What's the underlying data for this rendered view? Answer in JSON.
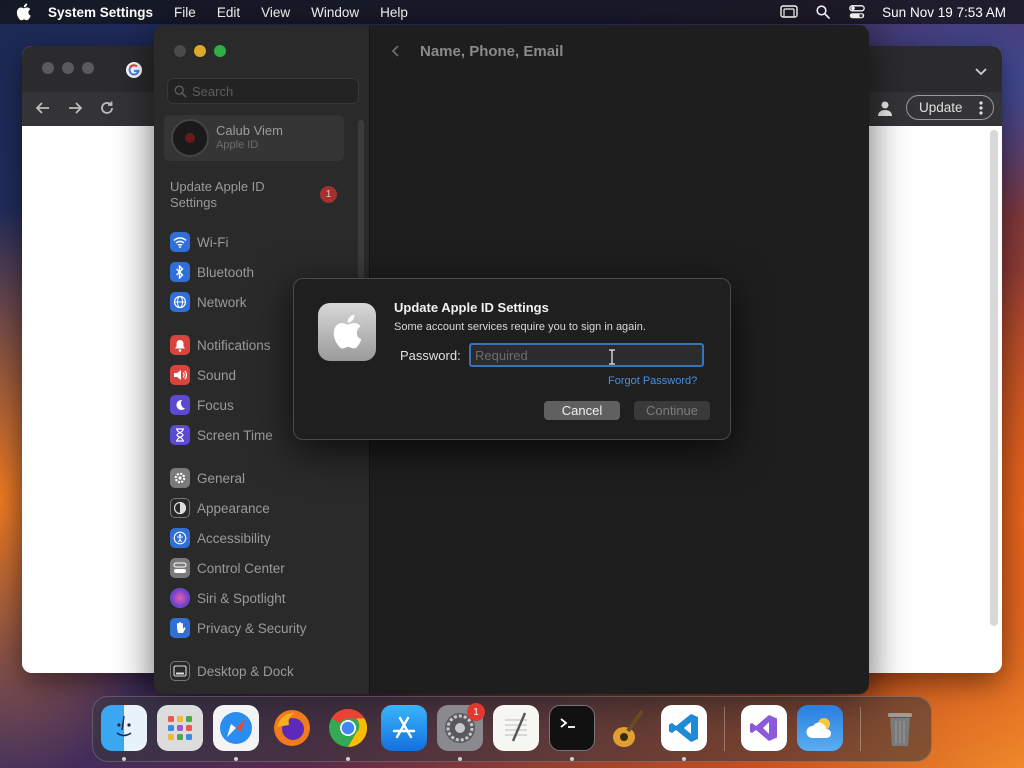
{
  "menubar": {
    "app_name": "System Settings",
    "items": [
      "File",
      "Edit",
      "View",
      "Window",
      "Help"
    ],
    "clock": "Sun Nov 19  7:53 AM"
  },
  "chrome": {
    "update_label": "Update"
  },
  "settings": {
    "search_placeholder": "Search",
    "profile": {
      "name": "Calub Viem",
      "subtitle": "Apple ID"
    },
    "update_item": {
      "label": "Update Apple ID Settings",
      "badge": "1"
    },
    "sidebar_items": [
      {
        "label": "Wi-Fi",
        "icon": "wifi-icon",
        "color": "#2f6fd6"
      },
      {
        "label": "Bluetooth",
        "icon": "bluetooth-icon",
        "color": "#2f6fd6"
      },
      {
        "label": "Network",
        "icon": "network-globe-icon",
        "color": "#2f6fd6"
      },
      {
        "label": "Notifications",
        "icon": "bell-icon",
        "color": "#d9453c"
      },
      {
        "label": "Sound",
        "icon": "speaker-icon",
        "color": "#d9453c"
      },
      {
        "label": "Focus",
        "icon": "moon-icon",
        "color": "#5a4bd0"
      },
      {
        "label": "Screen Time",
        "icon": "hourglass-icon",
        "color": "#5a4bd0"
      },
      {
        "label": "General",
        "icon": "gear-icon",
        "color": "#7a7a7a"
      },
      {
        "label": "Appearance",
        "icon": "appearance-icon",
        "color": "#2a2a2a"
      },
      {
        "label": "Accessibility",
        "icon": "accessibility-icon",
        "color": "#2f6fd6"
      },
      {
        "label": "Control Center",
        "icon": "control-center-icon",
        "color": "#7a7a7a"
      },
      {
        "label": "Siri & Spotlight",
        "icon": "siri-icon",
        "color": "#b0489e"
      },
      {
        "label": "Privacy & Security",
        "icon": "hand-icon",
        "color": "#2f6fd6"
      },
      {
        "label": "Desktop & Dock",
        "icon": "dock-icon",
        "color": "#2a2a2a"
      }
    ],
    "main_title": "Name, Phone, Email"
  },
  "dialog": {
    "title": "Update Apple ID Settings",
    "message": "Some account services require you to sign in again.",
    "password_label": "Password:",
    "password_placeholder": "Required",
    "password_value": "",
    "forgot_link": "Forgot Password?",
    "cancel_label": "Cancel",
    "continue_label": "Continue"
  },
  "dock": {
    "apps": [
      {
        "name": "Finder",
        "icon": "finder-icon",
        "running": true
      },
      {
        "name": "Launchpad",
        "icon": "launchpad-icon",
        "running": false
      },
      {
        "name": "Safari",
        "icon": "safari-icon",
        "running": true
      },
      {
        "name": "Firefox",
        "icon": "firefox-icon",
        "running": false
      },
      {
        "name": "Google Chrome",
        "icon": "chrome-icon",
        "running": true
      },
      {
        "name": "App Store",
        "icon": "app-store-icon",
        "running": false
      },
      {
        "name": "System Settings",
        "icon": "system-settings-icon",
        "running": true,
        "badge": "1"
      },
      {
        "name": "TextEdit",
        "icon": "textedit-icon",
        "running": false
      },
      {
        "name": "Terminal",
        "icon": "terminal-icon",
        "running": true
      },
      {
        "name": "GarageBand",
        "icon": "garageband-icon",
        "running": false
      },
      {
        "name": "Visual Studio Code",
        "icon": "vscode-icon",
        "running": true
      },
      {
        "name": "Visual Studio",
        "icon": "visual-studio-icon",
        "running": false
      },
      {
        "name": "Weather",
        "icon": "weather-icon",
        "running": false
      },
      {
        "name": "Trash",
        "icon": "trash-icon",
        "running": false
      }
    ]
  }
}
